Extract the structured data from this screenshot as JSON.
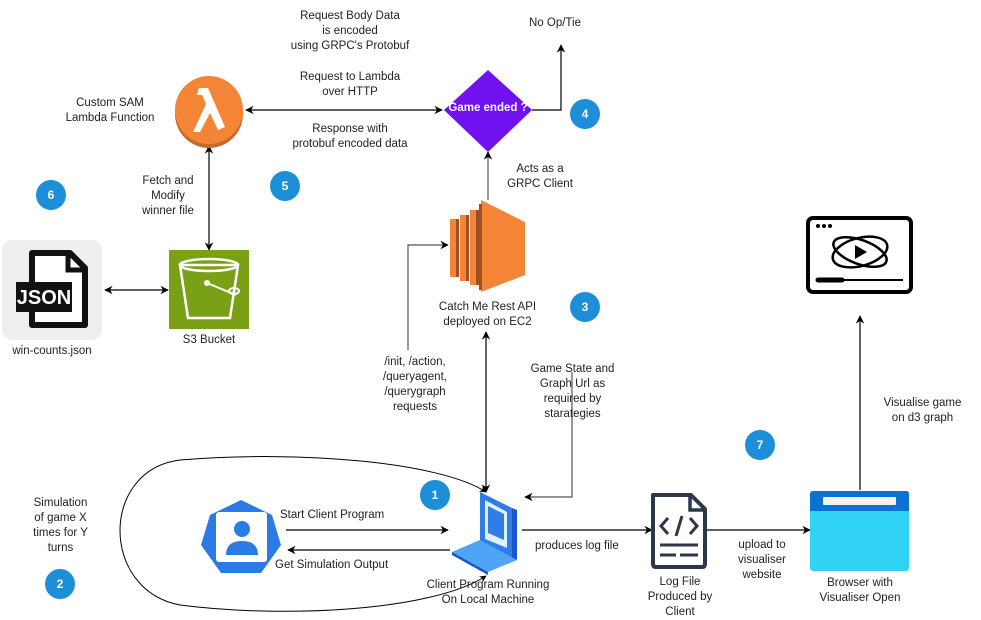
{
  "diagram": {
    "colors": {
      "lambda_orange": "#f58536",
      "ec2_orange": "#f58536",
      "ec2_dark": "#9d5025",
      "s3_green": "#7aa116",
      "decision_purple": "#7111f0",
      "badge_blue": "#1c8fd8",
      "user_blue": "#2c7be5",
      "browser_top": "#0a72d1",
      "browser_body": "#32d4f5",
      "line": "#000000"
    },
    "nodes": {
      "lambda": {
        "label": "Custom SAM\nLambda Function",
        "icon": "lambda-icon"
      },
      "decision": {
        "label": "Game ended ?",
        "icon": "decision-diamond"
      },
      "ec2": {
        "label": "Catch Me Rest  API\ndeployed on EC2",
        "icon": "ec2-icon"
      },
      "s3": {
        "label": "S3 Bucket",
        "icon": "s3-bucket-icon"
      },
      "json_file": {
        "label": "win-counts.json",
        "icon": "json-file-icon",
        "badge_text": "JSON"
      },
      "user": {
        "icon": "user-icon"
      },
      "laptop": {
        "label": "Client Program Running\nOn Local Machine",
        "icon": "laptop-icon"
      },
      "log_file": {
        "label": "Log File\nProduced by\nClient",
        "icon": "code-file-icon"
      },
      "browser": {
        "label": "Browser with\nVisualiser Open",
        "icon": "browser-icon"
      },
      "video": {
        "icon": "video-player-icon"
      }
    },
    "edge_labels": {
      "request_body": "Request Body Data\nis encoded\nusing GRPC's Protobuf",
      "request_lambda": "Request to Lambda\nover HTTP",
      "response": "Response with\nprotobuf encoded data",
      "no_op": "No Op/Tie",
      "grpc_client": "Acts as a\nGRPC Client",
      "fetch_modify": "Fetch and\nModify\nwinner file",
      "endpoints": "/init, /action,\n/queryagent,\n/querygraph\nrequests",
      "game_state": "Game State and\nGraph Url as\nrequired by\nstarategies",
      "simulation": "Simulation\nof game X\ntimes for Y\nturns",
      "start_client": "Start Client Program",
      "get_output": "Get Simulation Output",
      "produces_log": "produces log file",
      "upload": "upload to\nvisualiser\nwebsite",
      "visualise": "Visualise game\non d3 graph"
    },
    "badges": [
      "1",
      "2",
      "3",
      "4",
      "5",
      "6",
      "7"
    ]
  }
}
